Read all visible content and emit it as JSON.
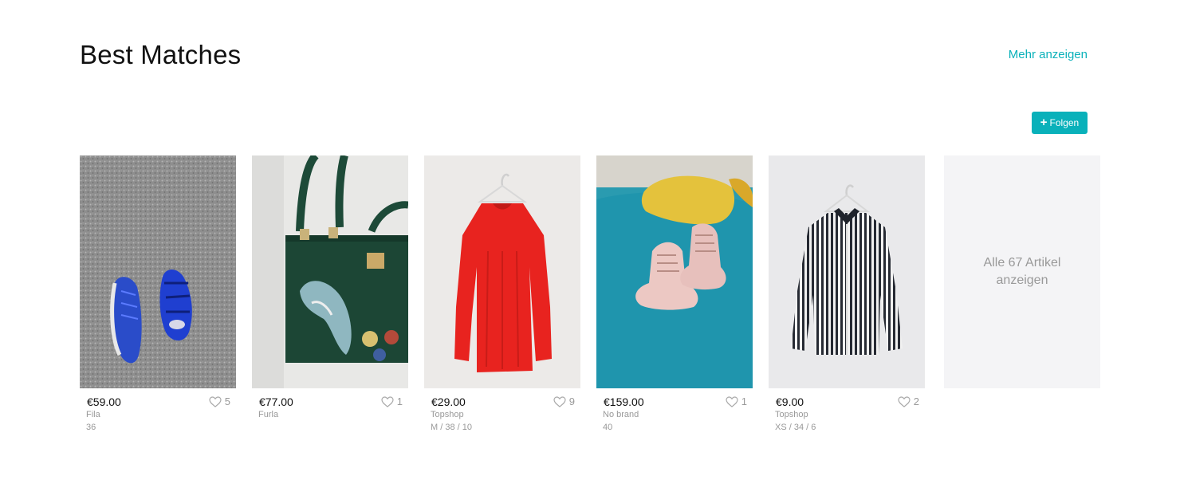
{
  "section": {
    "title": "Best Matches",
    "more_link": "Mehr anzeigen"
  },
  "follow_button": {
    "icon": "+",
    "label": "Folgen"
  },
  "colors": {
    "accent": "#09b1ba",
    "muted_text": "#999999",
    "see_all_bg": "#f4f4f6"
  },
  "items": [
    {
      "price": "€59.00",
      "likes": "5",
      "brand": "Fila",
      "size": "36",
      "image": "blue-sneakers-on-grey-carpet"
    },
    {
      "price": "€77.00",
      "likes": "1",
      "brand": "Furla",
      "size": "",
      "image": "green-handbag-with-patches"
    },
    {
      "price": "€29.00",
      "likes": "9",
      "brand": "Topshop",
      "size": "M / 38 / 10",
      "image": "red-dress-on-hanger"
    },
    {
      "price": "€159.00",
      "likes": "1",
      "brand": "No brand",
      "size": "40",
      "image": "pink-boots-on-blue-bedspread"
    },
    {
      "price": "€9.00",
      "likes": "2",
      "brand": "Topshop",
      "size": "XS / 34 / 6",
      "image": "striped-shirt-on-hanger"
    }
  ],
  "see_all": {
    "label": "Alle 67 Artikel anzeigen"
  }
}
